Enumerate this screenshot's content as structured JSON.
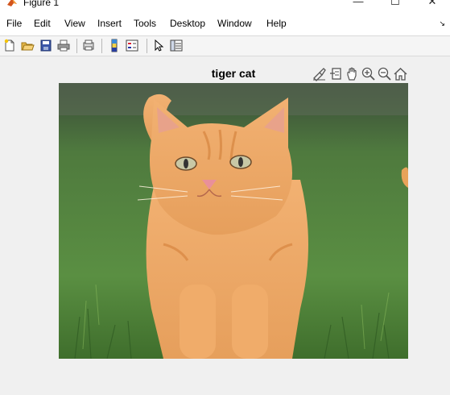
{
  "window": {
    "title": "Figure 1",
    "minimize_glyph": "—",
    "maximize_glyph": "☐",
    "close_glyph": "✕"
  },
  "menu": {
    "items": [
      "File",
      "Edit",
      "View",
      "Insert",
      "Tools",
      "Desktop",
      "Window",
      "Help"
    ],
    "dock_glyph": "↘"
  },
  "toolbar": {
    "icons": [
      "new-figure-icon",
      "open-file-icon",
      "save-icon",
      "print-icon",
      "link-plot-icon",
      "insert-colorbar-icon",
      "insert-legend-icon",
      "edit-plot-icon",
      "property-inspector-icon"
    ]
  },
  "axes_toolbar": {
    "icons": [
      "brush-icon",
      "data-tips-icon",
      "pan-icon",
      "zoom-in-icon",
      "zoom-out-icon",
      "restore-view-icon"
    ]
  },
  "figure": {
    "title": "tiger cat"
  },
  "image_subject": "photo of orange tabby cat walking on green grass"
}
